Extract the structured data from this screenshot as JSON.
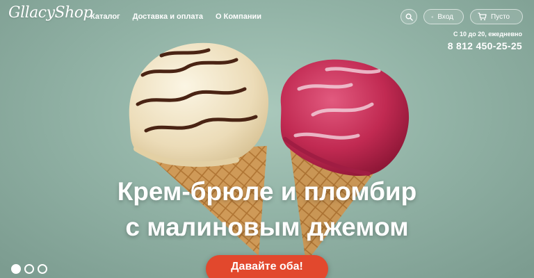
{
  "brand": {
    "logo_text": "GllacyShop"
  },
  "nav": {
    "items": [
      {
        "label": "Каталог"
      },
      {
        "label": "Доставка и оплата"
      },
      {
        "label": "О Компании"
      }
    ]
  },
  "header": {
    "login_label": "Вход",
    "cart_label": "Пусто",
    "hours": "С 10 до 20, ежедневно",
    "phone": "8 812 450-25-25"
  },
  "hero": {
    "title_line1": "Крем-брюле и пломбир",
    "title_line2": "с малиновым джемом",
    "cta_label": "Давайте оба!",
    "slides_count": 3,
    "active_slide": 1
  },
  "colors": {
    "background": "#93b4a7",
    "accent": "#e2482d",
    "text": "#ffffff"
  },
  "icons": [
    "search-icon",
    "login-icon",
    "cart-icon"
  ]
}
